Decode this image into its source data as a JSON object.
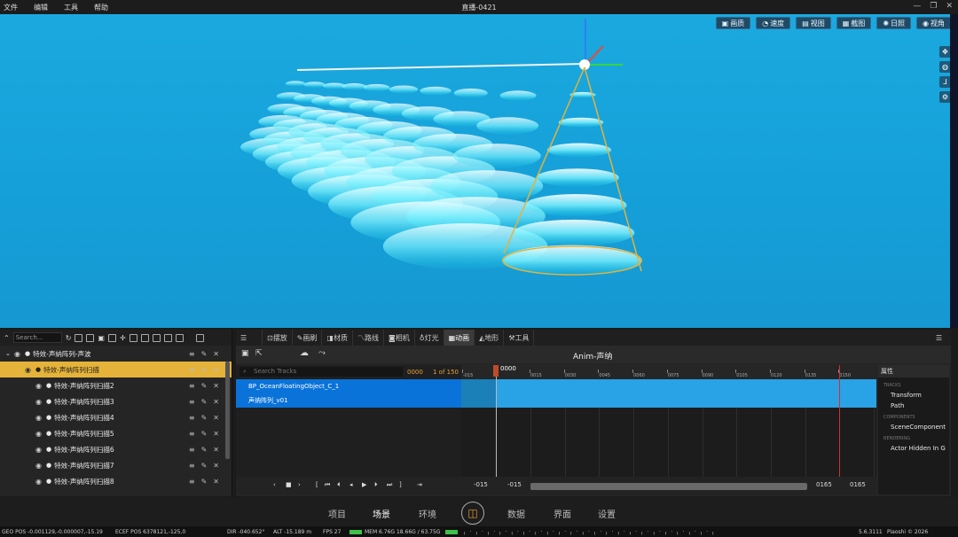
{
  "window": {
    "menus": [
      "文件",
      "编辑",
      "工具",
      "帮助"
    ],
    "title": "直播-0421",
    "controls": [
      "—",
      "❐",
      "✕"
    ]
  },
  "viewport": {
    "toolbar": [
      {
        "icon": "image-icon",
        "label": "画质"
      },
      {
        "icon": "speed-icon",
        "label": "速度"
      },
      {
        "icon": "view-icon",
        "label": "视图"
      },
      {
        "icon": "screenshot-icon",
        "label": "截图"
      },
      {
        "icon": "sun-icon",
        "label": "日照"
      },
      {
        "icon": "eye-icon",
        "label": "视角"
      }
    ],
    "side_tools": [
      "move-icon",
      "globe-icon",
      "axis-icon",
      "settings-icon"
    ]
  },
  "outliner": {
    "search_placeholder": "Search...",
    "items": [
      {
        "label": "特效-声纳阵列-声波",
        "selected": false,
        "indent": 0
      },
      {
        "label": "特效-声纳阵列扫描",
        "selected": true,
        "indent": 1
      },
      {
        "label": "特效-声纳阵列扫描2",
        "selected": false,
        "indent": 2
      },
      {
        "label": "特效-声纳阵列扫描3",
        "selected": false,
        "indent": 2
      },
      {
        "label": "特效-声纳阵列扫描4",
        "selected": false,
        "indent": 2
      },
      {
        "label": "特效-声纳阵列扫描5",
        "selected": false,
        "indent": 2
      },
      {
        "label": "特效-声纳阵列扫描6",
        "selected": false,
        "indent": 2
      },
      {
        "label": "特效-声纳阵列扫描7",
        "selected": false,
        "indent": 2
      },
      {
        "label": "特效-声纳阵列扫描8",
        "selected": false,
        "indent": 2
      }
    ]
  },
  "sequencer": {
    "tabs": [
      {
        "icon": "layout-icon",
        "label": "摆放",
        "active": false
      },
      {
        "icon": "brush-icon",
        "label": "画刷",
        "active": false
      },
      {
        "icon": "material-icon",
        "label": "材质",
        "active": false
      },
      {
        "icon": "route-icon",
        "label": "路线",
        "active": false
      },
      {
        "icon": "camera-icon",
        "label": "相机",
        "active": false
      },
      {
        "icon": "light-icon",
        "label": "灯光",
        "active": false
      },
      {
        "icon": "anim-icon",
        "label": "动画",
        "active": true
      },
      {
        "icon": "terrain-icon",
        "label": "地形",
        "active": false
      },
      {
        "icon": "tool-icon",
        "label": "工具",
        "active": false
      }
    ],
    "title": "Anim-声纳",
    "search_placeholder": "Search Tracks",
    "frame": "0000",
    "count": "1 of 150",
    "tracks": [
      "BP_OceanFloatingObject_C_1",
      "声纳阵列_v01"
    ],
    "playhead_label": "0000",
    "ruler_ticks": [
      "-015",
      "0015",
      "0030",
      "0045",
      "0060",
      "0075",
      "0090",
      "0105",
      "0120",
      "0135",
      "0150"
    ],
    "bottom": {
      "start_a": "-015",
      "start_b": "-015",
      "end_a": "0165",
      "end_b": "0165"
    },
    "properties": {
      "header": "属性",
      "groups": [
        {
          "name": "TRACKS",
          "items": [
            "Transform",
            "Path"
          ]
        },
        {
          "name": "COMPONENTS",
          "items": [
            "SceneComponent"
          ]
        },
        {
          "name": "RENDERING",
          "items": [
            "Actor Hidden In G"
          ]
        }
      ]
    }
  },
  "bottom_nav": {
    "items": [
      "项目",
      "场景",
      "环境",
      "数据",
      "界面",
      "设置"
    ],
    "active": "场景"
  },
  "status": {
    "geo": "GEO POS  -0.001129,-0.000007,-15.19",
    "ecef": "ECEF POS  6378121,-125,0",
    "dir": "DIR  -040.652°",
    "alt": "ALT  -15.189 m",
    "fps": "FPS  27",
    "mem": "MEM  6.76G   18.66G / 63.75G",
    "version": "5.6.3111",
    "copyright": "Piaoshi © 2026"
  }
}
